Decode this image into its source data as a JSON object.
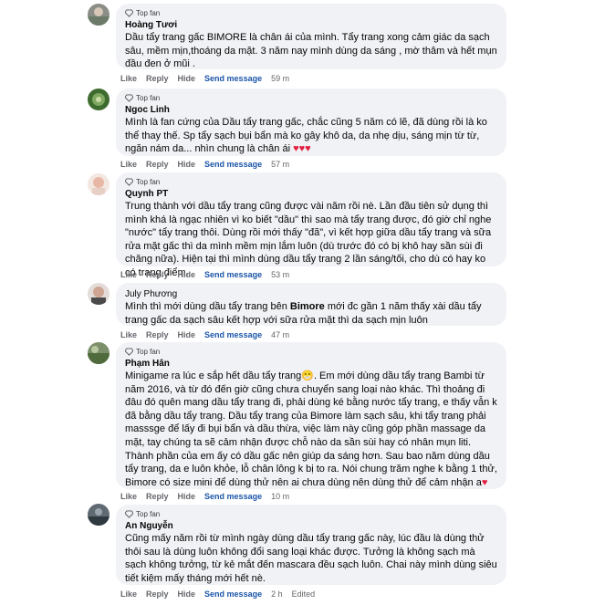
{
  "badge_label": "Top fan",
  "actions": {
    "like": "Like",
    "reply": "Reply",
    "hide": "Hide",
    "send": "Send message"
  },
  "comments": [
    {
      "name": "Hoàng Tươi",
      "text": "Dầu tẩy trang gấc BIMORE là chân ái của mình. Tẩy trang xong cảm giác da sạch sâu, mềm mịn,thoáng da mặt. 3 năm nay mình dùng da sáng , mờ thâm và hết mụn đầu đen ở mũi .",
      "time": "59 m",
      "badge": true
    },
    {
      "name": "Ngoc Linh",
      "text": "Mình là fan cứng của Dầu tẩy trang gấc, chắc cũng 5 năm có lẽ, đã dùng rồi là ko thể thay thế. Sp tẩy sạch bụi bẩn mà ko gây khô da, da nhẹ dịu, sáng mịn từ từ, ngăn nám da... nhìn chung là chân ái",
      "emoji": "♥♥♥",
      "time": "57 m",
      "badge": true
    },
    {
      "name": "Quynh PT",
      "text": "Trung thành với dầu tẩy trang cũng được vài năm rồi nè. Lần đầu tiên sử dụng thì mình khá là ngạc nhiên vì ko biết \"dầu\" thì sao mà tẩy trang được, đó giờ chỉ nghe \"nước\" tẩy trang thôi. Dùng rồi mới thấy \"đã\", vì kết hợp giữa dầu tẩy trang và sữa rửa mặt gấc thì da mình mềm mịn lắm luôn (dù trước đó có bị khô hay sần sùi đi chăng nữa). Hiện tại thì mình dùng dầu tẩy trang 2 lần sáng/tối, cho dù có hay ko có trang điểm.",
      "time": "53 m",
      "badge": true
    },
    {
      "name": "July Phương",
      "text_pre": "Mình thì mới dùng dầu tẩy trang bên ",
      "text_bold": "Bimore",
      "text_post": " mới đc gần 1 năm thấy xài dầu tẩy trang gấc da sạch sâu kết hợp với sữa rửa mặt thì da sạch mịn luôn",
      "time": "47 m",
      "badge": false
    },
    {
      "name": "Phạm Hân",
      "text": "Minigame ra lúc e sắp hết dầu tẩy trang",
      "emoji_a": "😁",
      "text2": ". Em mới dùng dầu tẩy trang Bambi từ năm 2016, và từ đó đến giờ cũng chưa chuyển sang loại nào khác. Thì thoảng đi đâu đó quên mang dầu tẩy trang đi, phải dùng ké bằng nước tẩy trang, e thấy vẫn k đã bằng dầu tẩy trang. Dầu tẩy trang của Bimore làm sạch sâu, khi tẩy trang phải masssge để lấy đi bụi bẩn và dầu thừa, việc làm này cũng góp phần massage da mặt, tay chúng ta sẽ cảm nhận được chỗ nào da sần sùi hay có nhân mụn liti. Thành phần của em ấy có dầu gấc nên giúp da sáng hơn. Sau bao năm dùng dầu tẩy trang, da e luôn khỏe, lỗ chân lông k bị to ra. Nói chung trăm nghe k bằng 1 thử, Bimore có size mini để dùng thử nên ai chưa dùng nên dùng thử để cảm nhận a",
      "emoji_b": "♥",
      "time": "10 m",
      "badge": true
    },
    {
      "name": "An Nguyễn",
      "text": "Cũng mấy năm rồi từ mình ngày dùng dầu tẩy trang gấc này, lúc đầu là dùng thử thôi sau là dùng luôn không đổi sang loại khác được. Tưởng là không sạch mà sạch không tưởng, từ kẻ mắt đến mascara đều sạch luôn. Chai này mình dùng siêu tiết kiệm mấy tháng mới hết nè.",
      "time": "2 h",
      "edited": "Edited",
      "badge": true
    }
  ]
}
